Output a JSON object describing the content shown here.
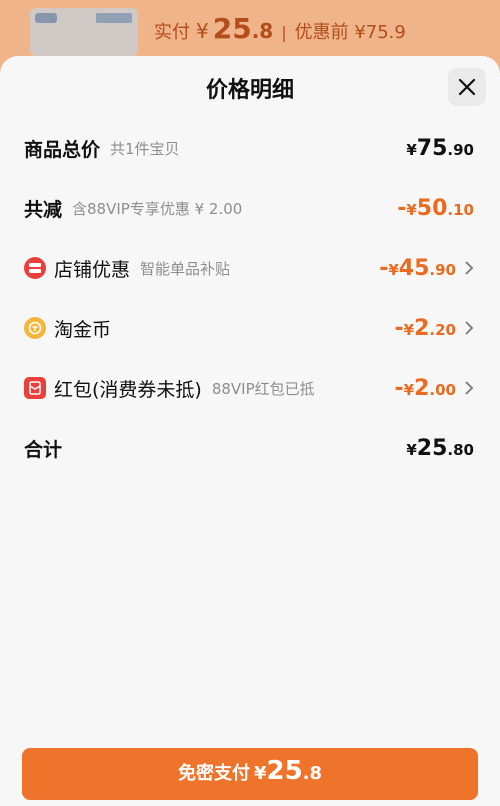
{
  "background": {
    "paid_label": "实付",
    "currency": "¥",
    "paid_int": "25",
    "paid_frac": ".8",
    "separator": "|",
    "original_label": "优惠前 ¥75.9"
  },
  "sheet": {
    "title": "价格明细"
  },
  "rows": [
    {
      "label": "商品总价",
      "sub": "共1件宝贝",
      "sign": "",
      "currency": "¥",
      "int": "75",
      "frac": ".90",
      "color": "#111111"
    },
    {
      "label": "共减",
      "sub": "含88VIP专享优惠 ¥ 2.00",
      "sign": "-",
      "currency": "¥",
      "int": "50",
      "frac": ".10",
      "color": "#ea6a1f"
    },
    {
      "label": "店铺优惠",
      "sub": "智能单品补贴",
      "sign": "-",
      "currency": "¥",
      "int": "45",
      "frac": ".90",
      "color": "#ea6a1f",
      "icon": "store-coupon-icon"
    },
    {
      "label": "淘金币",
      "sub": "",
      "sign": "-",
      "currency": "¥",
      "int": "2",
      "frac": ".20",
      "color": "#ea6a1f",
      "icon": "gold-coin-icon"
    },
    {
      "label": "红包(消费券未抵)",
      "sub": "88VIP红包已抵",
      "sign": "-",
      "currency": "¥",
      "int": "2",
      "frac": ".00",
      "color": "#ea6a1f",
      "icon": "red-packet-icon"
    },
    {
      "label": "合计",
      "sub": "",
      "sign": "",
      "currency": "¥",
      "int": "25",
      "frac": ".80",
      "color": "#111111"
    }
  ],
  "pay_button": {
    "label": "免密支付",
    "currency": "¥",
    "int": "25",
    "frac": ".8"
  }
}
